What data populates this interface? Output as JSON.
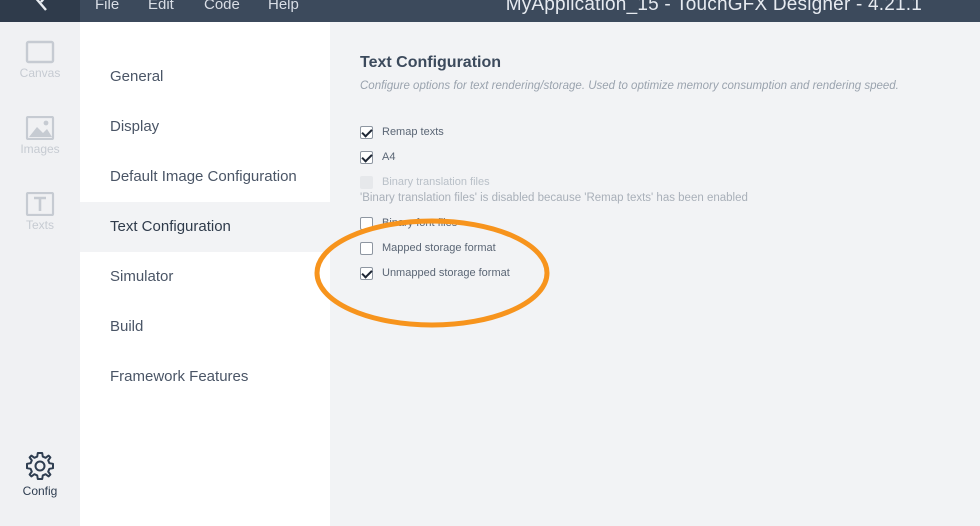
{
  "menubar": {
    "menus": [
      "File",
      "Edit",
      "Code",
      "Help"
    ],
    "app_title": "MyApplication_15 - TouchGFX Designer - 4.21.1"
  },
  "rail": {
    "items": [
      {
        "label": "Canvas",
        "icon": "canvas-icon"
      },
      {
        "label": "Images",
        "icon": "images-icon"
      },
      {
        "label": "Texts",
        "icon": "texts-icon"
      },
      {
        "label": "Config",
        "icon": "gear-icon"
      }
    ]
  },
  "nav": {
    "items": [
      {
        "label": "General"
      },
      {
        "label": "Display"
      },
      {
        "label": "Default Image Configuration"
      },
      {
        "label": "Text Configuration"
      },
      {
        "label": "Simulator"
      },
      {
        "label": "Build"
      },
      {
        "label": "Framework Features"
      }
    ],
    "active": "Text Configuration"
  },
  "content": {
    "title": "Text Configuration",
    "description": "Configure options for text rendering/storage. Used to optimize memory consumption and rendering speed.",
    "options": [
      {
        "label": "Remap texts",
        "checked": true,
        "enabled": true
      },
      {
        "label": "A4",
        "checked": true,
        "enabled": true
      },
      {
        "label": "Binary translation files",
        "checked": false,
        "enabled": false
      },
      {
        "label": "Binary font files",
        "checked": false,
        "enabled": true
      },
      {
        "label": "Mapped storage format",
        "checked": false,
        "enabled": true
      },
      {
        "label": "Unmapped storage format",
        "checked": true,
        "enabled": true
      }
    ],
    "disabled_note": "'Binary translation files' is disabled because 'Remap texts' has been enabled"
  },
  "colors": {
    "topbar": "#3c4a5c",
    "annotation": "#f7941d"
  }
}
